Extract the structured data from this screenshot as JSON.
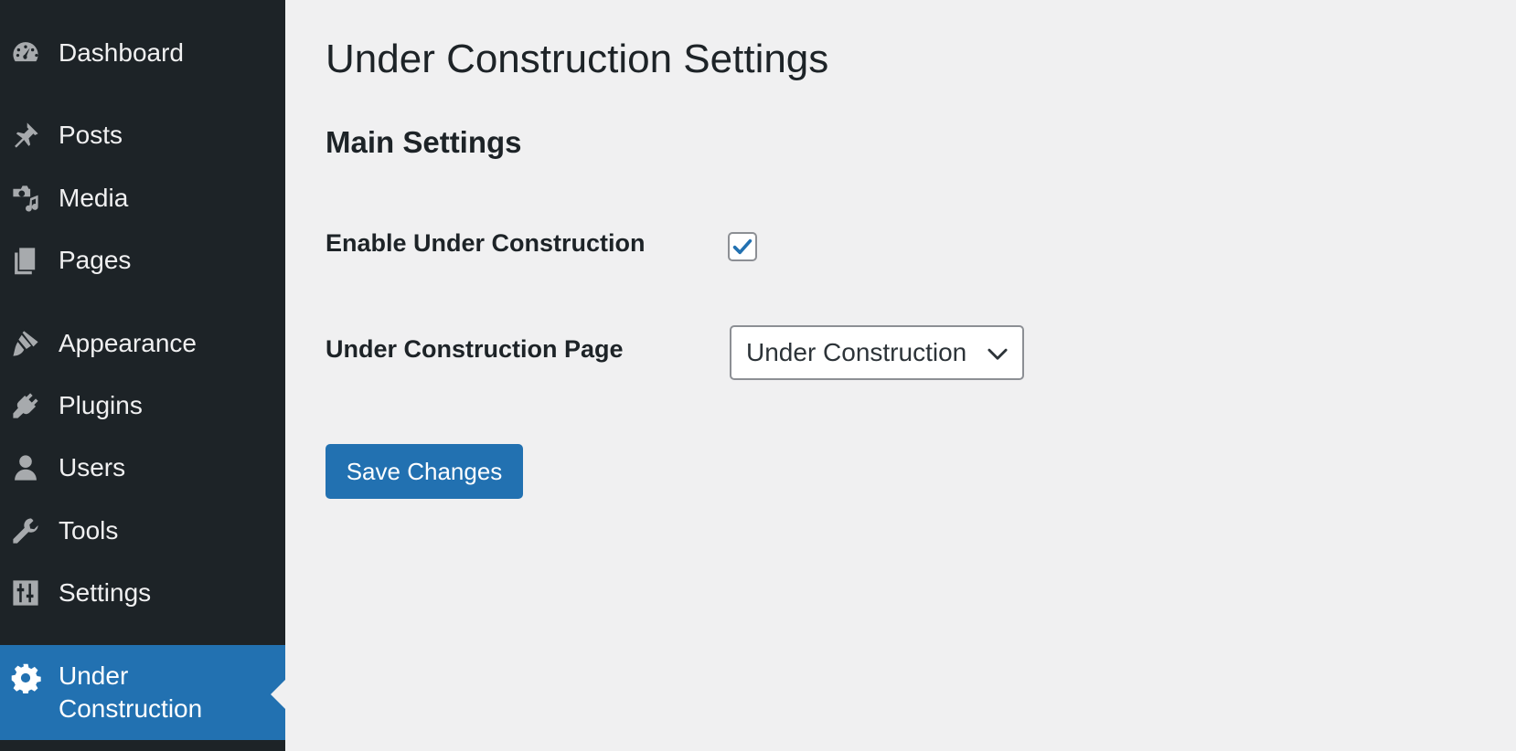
{
  "sidebar": {
    "items": [
      {
        "label": "Dashboard",
        "icon": "dashboard-icon"
      },
      {
        "label": "Posts",
        "icon": "pin-icon"
      },
      {
        "label": "Media",
        "icon": "media-icon"
      },
      {
        "label": "Pages",
        "icon": "pages-icon"
      },
      {
        "label": "Appearance",
        "icon": "paintbrush-icon"
      },
      {
        "label": "Plugins",
        "icon": "plug-icon"
      },
      {
        "label": "Users",
        "icon": "user-icon"
      },
      {
        "label": "Tools",
        "icon": "wrench-icon"
      },
      {
        "label": "Settings",
        "icon": "sliders-icon"
      },
      {
        "label": "Under Construction",
        "icon": "gear-icon",
        "active": true
      }
    ]
  },
  "main": {
    "page_title": "Under Construction Settings",
    "section_title": "Main Settings",
    "enable_label": "Enable Under Construction",
    "enable_checked": true,
    "page_label": "Under Construction Page",
    "page_select_value": "Under Construction",
    "save_label": "Save Changes"
  },
  "colors": {
    "sidebar_bg": "#1d2327",
    "accent": "#2271b1",
    "content_bg": "#f0f0f1"
  }
}
